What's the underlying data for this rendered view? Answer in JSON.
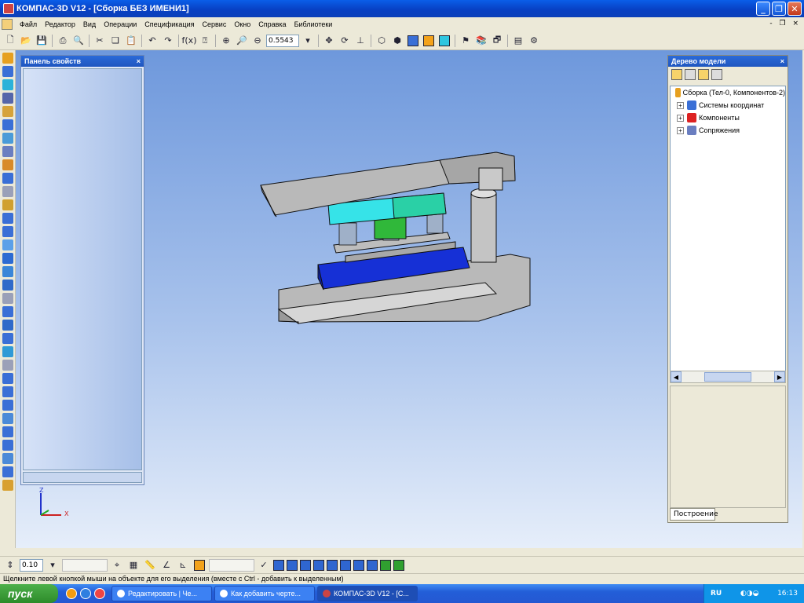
{
  "window": {
    "title": "КОМПАС-3D V12 - [Сборка БЕЗ ИМЕНИ1]",
    "minimize_label": "_",
    "maximize_label": "❐",
    "close_label": "✕"
  },
  "menu": {
    "items": [
      "Файл",
      "Редактор",
      "Вид",
      "Операции",
      "Спецификация",
      "Сервис",
      "Окно",
      "Справка",
      "Библиотеки"
    ],
    "right_controls": "- ❐ ×"
  },
  "toolbar": {
    "zoom_value": "0.5543"
  },
  "properties_panel": {
    "title": "Панель свойств",
    "close_label": "×"
  },
  "model_tree": {
    "title": "Дерево модели",
    "close_label": "×",
    "root": "Сборка (Тел-0, Компонентов-2)",
    "nodes": [
      "Системы координат",
      "Компоненты",
      "Сопряжения"
    ],
    "tab_label": "Построение"
  },
  "axis": {
    "z_label": "Z",
    "x_label": "X"
  },
  "bottom_toolbar": {
    "step_value": "0.10"
  },
  "statusbar": {
    "text": "Щелкните левой кнопкой мыши на объекте для его выделения (вместе с Ctrl - добавить к выделенным)"
  },
  "taskbar": {
    "start_label": "пуск",
    "tasks": [
      "Редактировать | Че...",
      "Как добавить черте...",
      "КОМПАС-3D V12 - [С..."
    ],
    "lang": "RU",
    "clock": "16:13"
  },
  "colors": {
    "titlebar": "#0841c4",
    "viewport_top": "#6e98dc",
    "viewport_bottom": "#e6eefa",
    "part_gray": "#b9b9b9",
    "part_cyan": "#36e3e8",
    "part_green": "#30b83a",
    "part_blue": "#1630d6"
  }
}
